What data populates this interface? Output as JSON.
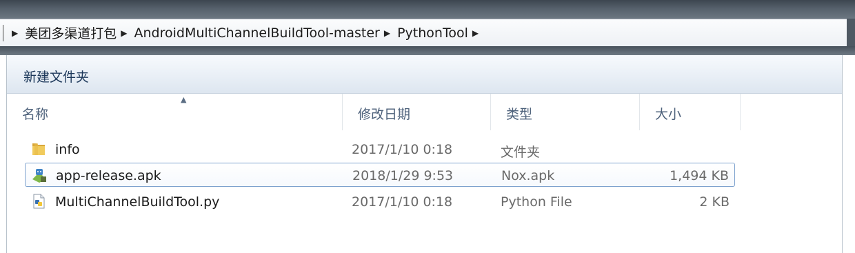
{
  "address": {
    "crumbs": [
      "美团多渠道打包",
      "AndroidMultiChannelBuildTool-master",
      "PythonTool"
    ]
  },
  "toolbar": {
    "new_folder_label": "新建文件夹"
  },
  "columns": {
    "name": "名称",
    "date": "修改日期",
    "type": "类型",
    "size": "大小"
  },
  "files": [
    {
      "name": "info",
      "date": "2017/1/10 0:18",
      "type": "文件夹",
      "size": "",
      "icon": "folder-icon"
    },
    {
      "name": "app-release.apk",
      "date": "2018/1/29 9:53",
      "type": "Nox.apk",
      "size": "1,494 KB",
      "icon": "apk-icon",
      "selected": true
    },
    {
      "name": "MultiChannelBuildTool.py",
      "date": "2017/1/10 0:18",
      "type": "Python File",
      "size": "2 KB",
      "icon": "python-file-icon"
    }
  ],
  "colors": {
    "header_text": "#4c607a",
    "selection_border": "#7da2ce",
    "toolbar_text": "#1e395b"
  }
}
